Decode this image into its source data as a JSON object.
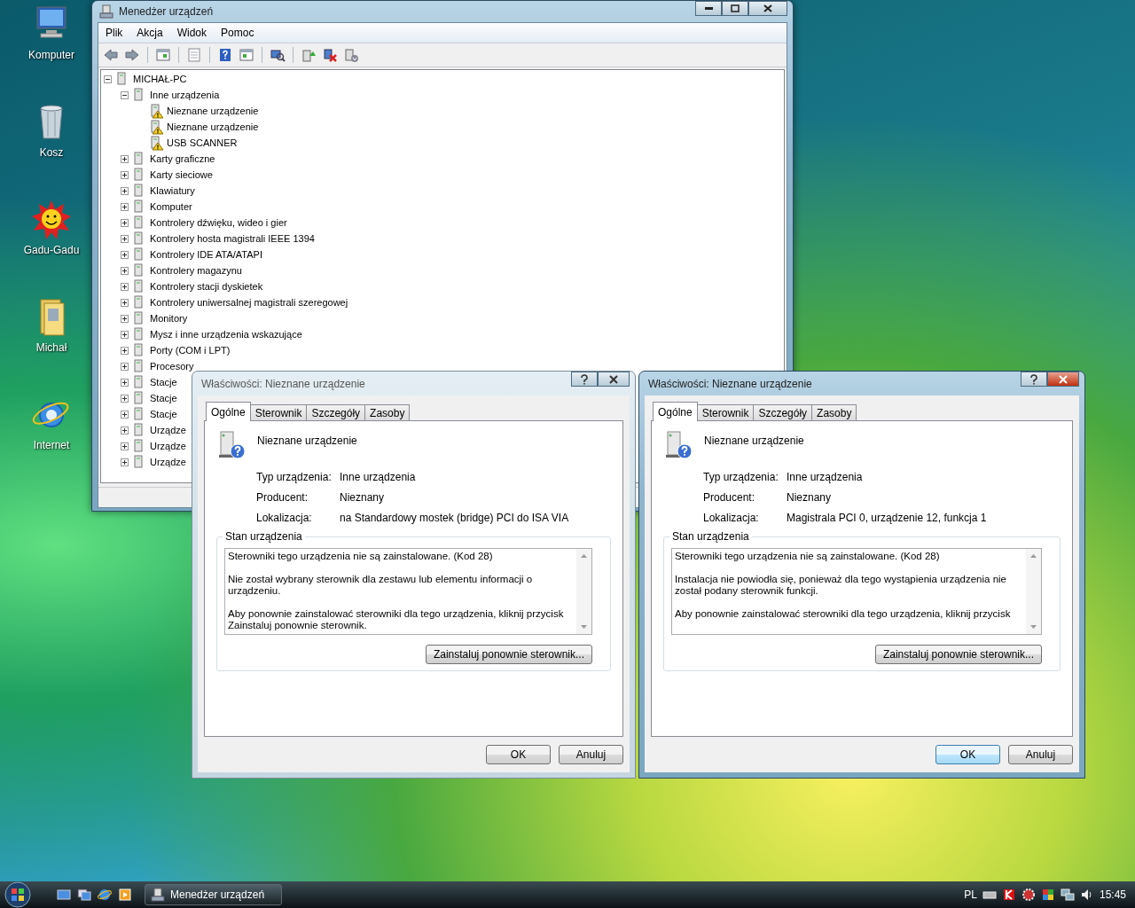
{
  "desktop_icons": [
    {
      "label": "Komputer",
      "kind": "computer"
    },
    {
      "label": "Kosz",
      "kind": "bin"
    },
    {
      "label": "Gadu-Gadu",
      "kind": "sun"
    },
    {
      "label": "Michał",
      "kind": "folder"
    },
    {
      "label": "Internet",
      "kind": "globe"
    }
  ],
  "device_manager": {
    "title": "Menedżer urządzeń",
    "menu": [
      "Plik",
      "Akcja",
      "Widok",
      "Pomoc"
    ],
    "tree": {
      "label": "MICHAŁ-PC",
      "expanded": true,
      "problem": false,
      "children": [
        {
          "label": "Inne urządzenia",
          "expanded": true,
          "problem": false,
          "children": [
            {
              "label": "Nieznane urządzenie",
              "problem": true
            },
            {
              "label": "Nieznane urządzenie",
              "problem": true
            },
            {
              "label": "USB SCANNER",
              "problem": true
            }
          ]
        },
        {
          "label": "Karty graficzne",
          "expanded": false,
          "problem": false
        },
        {
          "label": "Karty sieciowe",
          "expanded": false,
          "problem": false
        },
        {
          "label": "Klawiatury",
          "expanded": false,
          "problem": false
        },
        {
          "label": "Komputer",
          "expanded": false,
          "problem": false
        },
        {
          "label": "Kontrolery dźwięku, wideo i gier",
          "expanded": false,
          "problem": false
        },
        {
          "label": "Kontrolery hosta magistrali IEEE 1394",
          "expanded": false,
          "problem": false
        },
        {
          "label": "Kontrolery IDE ATA/ATAPI",
          "expanded": false,
          "problem": false
        },
        {
          "label": "Kontrolery magazynu",
          "expanded": false,
          "problem": false
        },
        {
          "label": "Kontrolery stacji dyskietek",
          "expanded": false,
          "problem": false
        },
        {
          "label": "Kontrolery uniwersalnej magistrali szeregowej",
          "expanded": false,
          "problem": false
        },
        {
          "label": "Monitory",
          "expanded": false,
          "problem": false
        },
        {
          "label": "Mysz i inne urządzenia wskazujące",
          "expanded": false,
          "problem": false
        },
        {
          "label": "Porty (COM i LPT)",
          "expanded": false,
          "problem": false
        },
        {
          "label": "Procesory",
          "expanded": false,
          "problem": false
        },
        {
          "label": "Stacje",
          "expanded": false,
          "problem": false
        },
        {
          "label": "Stacje",
          "expanded": false,
          "problem": false
        },
        {
          "label": "Stacje",
          "expanded": false,
          "problem": false
        },
        {
          "label": "Urządze",
          "expanded": false,
          "problem": false
        },
        {
          "label": "Urządze",
          "expanded": false,
          "problem": false
        },
        {
          "label": "Urządze",
          "expanded": false,
          "problem": false
        }
      ]
    }
  },
  "dialogs": [
    {
      "title": "Właściwości: Nieznane urządzenie",
      "active": false,
      "tabs": [
        {
          "label": "Ogólne",
          "selected": true
        },
        {
          "label": "Sterownik",
          "selected": false
        },
        {
          "label": "Szczegóły",
          "selected": false
        },
        {
          "label": "Zasoby",
          "selected": false
        }
      ],
      "device_name": "Nieznane urządzenie",
      "properties": [
        {
          "label": "Typ urządzenia:",
          "value": "Inne urządzenia"
        },
        {
          "label": "Producent:",
          "value": "Nieznany"
        },
        {
          "label": "Lokalizacja:",
          "value": "na Standardowy mostek (bridge) PCI do ISA VIA"
        }
      ],
      "status_label": "Stan urządzenia",
      "status_text": [
        "Sterowniki tego urządzenia nie są zainstalowane. (Kod 28)",
        "Nie został wybrany sterownik dla zestawu lub elementu informacji o urządzeniu.",
        "Aby ponownie zainstalować sterowniki dla tego urządzenia, kliknij przycisk Zainstaluj ponownie sterownik."
      ],
      "action_button": "Zainstaluj ponownie sterownik...",
      "ok": "OK",
      "cancel": "Anuluj"
    },
    {
      "title": "Właściwości: Nieznane urządzenie",
      "active": true,
      "tabs": [
        {
          "label": "Ogólne",
          "selected": true
        },
        {
          "label": "Sterownik",
          "selected": false
        },
        {
          "label": "Szczegóły",
          "selected": false
        },
        {
          "label": "Zasoby",
          "selected": false
        }
      ],
      "device_name": "Nieznane urządzenie",
      "properties": [
        {
          "label": "Typ urządzenia:",
          "value": "Inne urządzenia"
        },
        {
          "label": "Producent:",
          "value": "Nieznany"
        },
        {
          "label": "Lokalizacja:",
          "value": "Magistrala PCI 0, urządzenie 12, funkcja 1"
        }
      ],
      "status_label": "Stan urządzenia",
      "status_text": [
        "Sterowniki tego urządzenia nie są zainstalowane. (Kod 28)",
        "Instalacja nie powiodła się, ponieważ dla tego wystąpienia urządzenia nie został podany sterownik funkcji.",
        "Aby ponownie zainstalować sterowniki dla tego urządzenia, kliknij przycisk"
      ],
      "action_button": "Zainstaluj ponownie sterownik...",
      "ok": "OK",
      "cancel": "Anuluj"
    }
  ],
  "taskbar": {
    "task": "Menedżer urządzeń",
    "language": "PL",
    "time": "15:45"
  }
}
